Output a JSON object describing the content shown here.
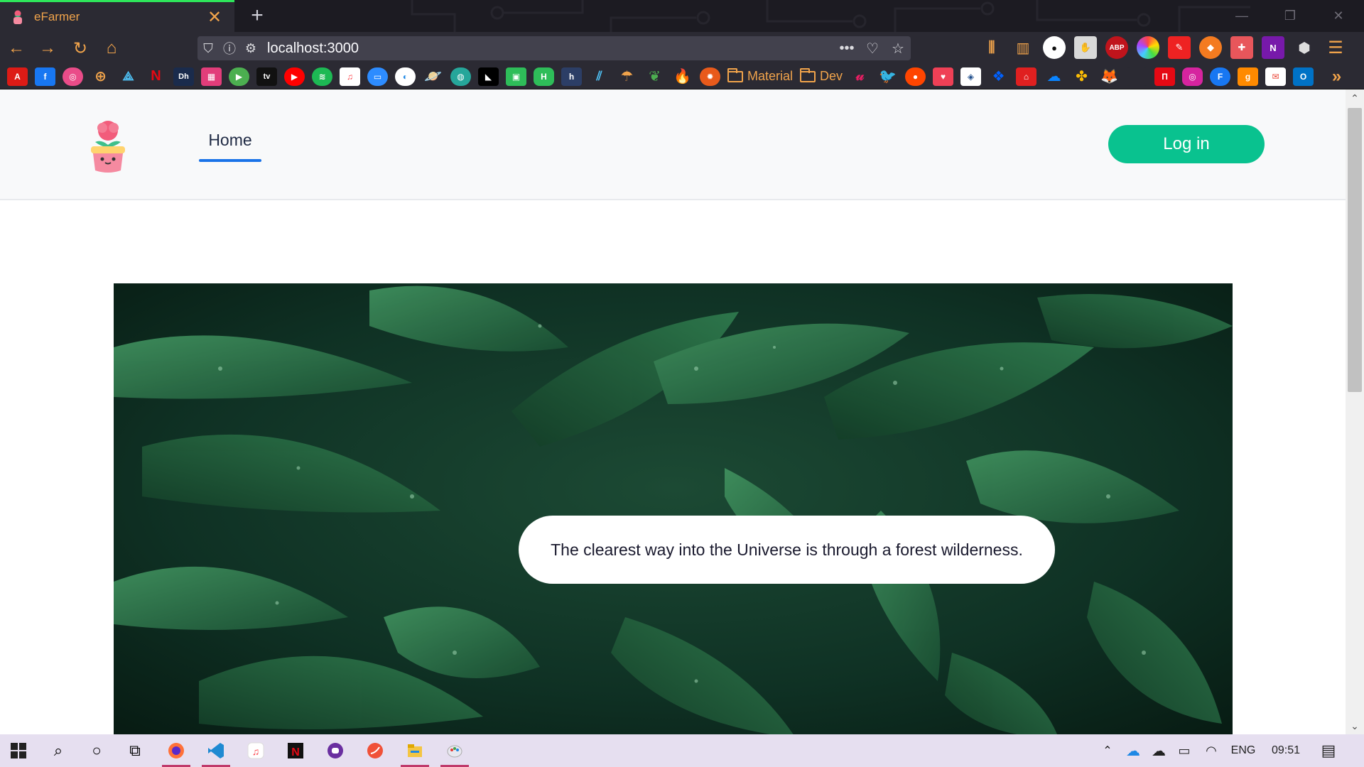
{
  "browser": {
    "tab_title": "eFarmer",
    "tab_close": "✕",
    "new_tab": "+",
    "url": "localhost:3000",
    "page_actions": "•••",
    "window_min": "—",
    "window_restore": "❐",
    "window_close": "✕",
    "accent_color": "#f0a34b",
    "tab_indicator_color": "#2ee65b"
  },
  "nav_controls": {
    "back": "←",
    "forward": "→",
    "reload": "↻",
    "home": "⌂"
  },
  "extensions": [
    "library-icon",
    "sidebar-icon",
    "github-icon",
    "grab-icon",
    "abp-icon",
    "color-picker-icon",
    "pen-icon",
    "fox-icon",
    "gift-icon",
    "onenote-icon",
    "cube-icon",
    "menu-icon"
  ],
  "extension_labels": {
    "abp": "ABP",
    "onenote": "N"
  },
  "bookmarks": {
    "folder_material": "Material",
    "folder_dev": "Dev",
    "more": "»",
    "labels": {
      "angular": "A",
      "facebook": "f",
      "netflix": "N",
      "devhunt": "Dh",
      "appletv": "tv",
      "hashnode": "H",
      "h": "h",
      "instagram_f": "F",
      "g": "g"
    }
  },
  "app": {
    "nav_home": "Home",
    "login_button": "Log in",
    "login_color": "#09c28f",
    "hero_quote": "The clearest way into the Universe is through a forest wilderness."
  },
  "taskbar": {
    "language": "ENG",
    "time": "09:51"
  }
}
